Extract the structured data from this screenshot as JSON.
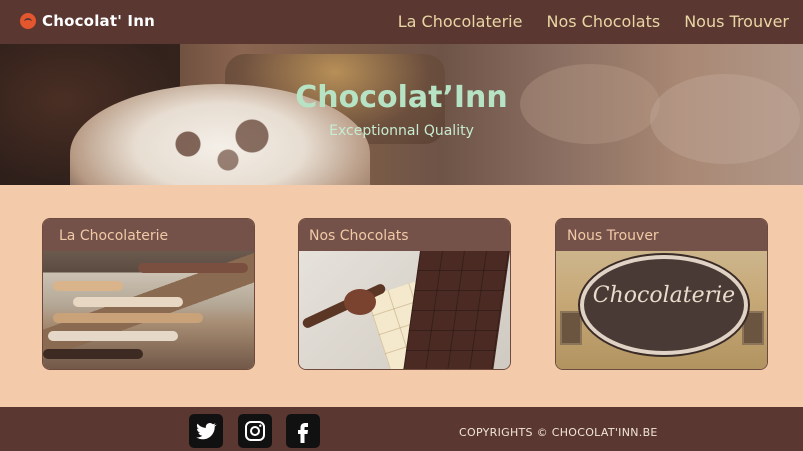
{
  "header": {
    "brand": "Chocolat' Inn",
    "nav": [
      {
        "label": "La Chocolaterie"
      },
      {
        "label": "Nos Chocolats"
      },
      {
        "label": "Nous Trouver"
      }
    ]
  },
  "hero": {
    "title": "Chocolat’Inn",
    "subtitle": "Exceptionnal Quality"
  },
  "cards": [
    {
      "title": "La Chocolaterie"
    },
    {
      "title": "Nos Chocolats"
    },
    {
      "title": "Nous Trouver",
      "sign_text": "Chocolaterie"
    }
  ],
  "footer": {
    "social_icons": [
      "twitter-icon",
      "instagram-icon",
      "facebook-icon"
    ],
    "copyright": "COPYRIGHTS © CHOCOLAT'INN.BE"
  },
  "colors": {
    "header_bg": "#5a3731",
    "page_bg": "#f3cbab",
    "accent_green": "#b7e3c5",
    "nav_text": "#e9d6a5",
    "card_title": "#f0c9a7"
  }
}
